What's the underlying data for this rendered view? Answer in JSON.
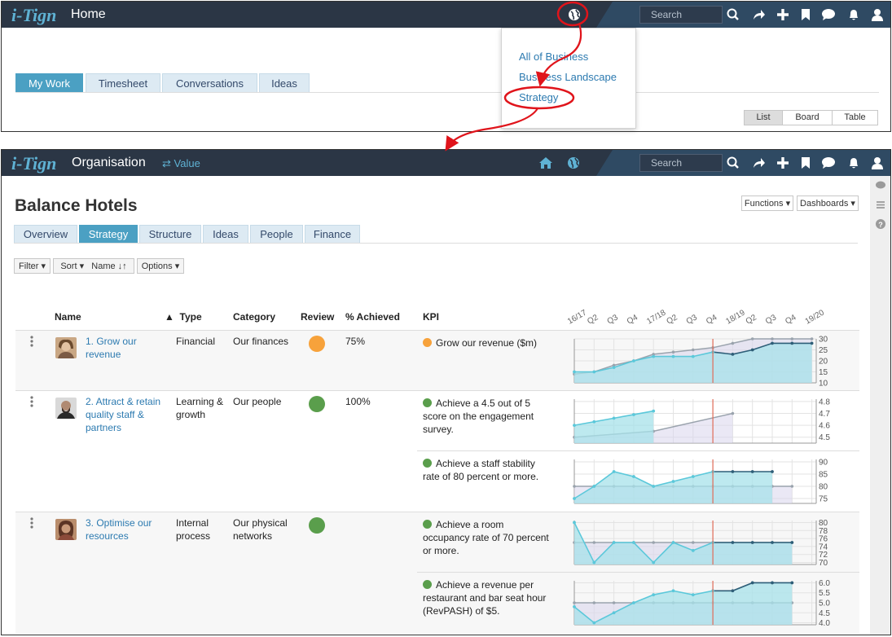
{
  "home": {
    "logo": "i-Tign",
    "title": "Home",
    "search_placeholder": "Search",
    "tabs": [
      {
        "label": "My Work",
        "active": true
      },
      {
        "label": "Timesheet",
        "active": false
      },
      {
        "label": "Conversations",
        "active": false
      },
      {
        "label": "Ideas",
        "active": false
      }
    ],
    "views": [
      "List",
      "Board",
      "Table"
    ],
    "active_view": "List",
    "dropdown": [
      "All of Business",
      "Business Landscape",
      "Strategy"
    ]
  },
  "org": {
    "logo": "i-Tign",
    "title": "Organisation",
    "value_link": "Value",
    "search_placeholder": "Search",
    "page_title": "Balance Hotels",
    "functions": "Functions",
    "dashboards": "Dashboards",
    "tabs": [
      {
        "label": "Overview",
        "active": false
      },
      {
        "label": "Strategy",
        "active": true
      },
      {
        "label": "Structure",
        "active": false
      },
      {
        "label": "Ideas",
        "active": false
      },
      {
        "label": "People",
        "active": false
      },
      {
        "label": "Finance",
        "active": false
      }
    ],
    "filter": "Filter",
    "sort": "Sort",
    "sort_by": "Name",
    "options": "Options",
    "columns": {
      "name": "Name",
      "type": "Type",
      "category": "Category",
      "review": "Review",
      "achieved": "% Achieved",
      "kpi": "KPI"
    },
    "timeline": [
      "16/17",
      "Q2",
      "Q3",
      "Q4",
      "17/18",
      "Q2",
      "Q3",
      "Q4",
      "18/19",
      "Q2",
      "Q3",
      "Q4",
      "19/20"
    ]
  },
  "objectives": [
    {
      "name": "1. Grow our revenue",
      "type": "Financial",
      "category": "Our finances",
      "review_color": "#f7a23b",
      "achieved": "75%"
    },
    {
      "name": "2. Attract & retain quality staff & partners",
      "type": "Learning & growth",
      "category": "Our people",
      "review_color": "#5a9e4c",
      "achieved": "100%"
    },
    {
      "name": "3. Optimise our resources",
      "type": "Internal process",
      "category": "Our physical networks",
      "review_color": "#5a9e4c",
      "achieved": ""
    }
  ],
  "kpis": [
    {
      "label": "Grow our revenue ($m)",
      "dot": "#f7a23b",
      "ticks": [
        "30",
        "25",
        "20",
        "15",
        "10"
      ],
      "ymin": 10,
      "ymax": 30,
      "actual": [
        15,
        15,
        17,
        20,
        22,
        22,
        22,
        24,
        23,
        25,
        28,
        28,
        28
      ],
      "target": [
        14,
        15,
        18,
        20,
        23,
        24,
        25,
        26,
        28,
        30,
        30,
        30,
        30
      ]
    },
    {
      "label": "Achieve a 4.5 out of 5 score on the engagement survey.",
      "dot": "#5a9e4c",
      "ticks": [
        "4.8",
        "4.7",
        "4.6",
        "4.5"
      ],
      "ymin": 4.45,
      "ymax": 4.82,
      "actual": [
        4.6,
        4.63,
        4.66,
        4.69,
        4.72,
        null,
        null,
        null,
        null,
        null,
        null,
        null,
        null
      ],
      "target": [
        4.5,
        null,
        null,
        null,
        4.55,
        null,
        null,
        null,
        4.7,
        null,
        null,
        null,
        null
      ]
    },
    {
      "label": "Achieve a staff stability rate of 80 percent or more.",
      "dot": "#5a9e4c",
      "ticks": [
        "90",
        "85",
        "80",
        "75"
      ],
      "ymin": 73,
      "ymax": 91,
      "actual": [
        75,
        80,
        86,
        84,
        80,
        82,
        84,
        86,
        86,
        86,
        86,
        null,
        null
      ],
      "target": [
        80,
        80,
        80,
        80,
        80,
        80,
        80,
        80,
        80,
        80,
        80,
        80,
        null
      ]
    },
    {
      "label": "Achieve a room occupancy rate of 70 percent or more.",
      "dot": "#5a9e4c",
      "ticks": [
        "80",
        "78",
        "76",
        "74",
        "72",
        "70"
      ],
      "ymin": 69.5,
      "ymax": 80.5,
      "actual": [
        80,
        70,
        75,
        75,
        70,
        75,
        73,
        75,
        75,
        75,
        75,
        75,
        null
      ],
      "target": [
        75,
        75,
        75,
        75,
        75,
        75,
        75,
        75,
        75,
        75,
        75,
        75,
        null
      ]
    },
    {
      "label": "Achieve a revenue per restaurant and bar seat hour (RevPASH) of $5.",
      "dot": "#5a9e4c",
      "ticks": [
        "6.0",
        "5.5",
        "5.0",
        "4.5",
        "4.0"
      ],
      "ymin": 3.9,
      "ymax": 6.1,
      "actual": [
        4.8,
        4.0,
        4.5,
        5.0,
        5.4,
        5.6,
        5.4,
        5.6,
        5.6,
        6.0,
        6.0,
        6.0,
        null
      ],
      "target": [
        5.0,
        5.0,
        5.0,
        5.0,
        5.0,
        5.0,
        5.0,
        5.0,
        5.0,
        5.0,
        5.0,
        5.0,
        null
      ]
    }
  ],
  "colors": {
    "topbar": "#2b3645",
    "accent": "#4ba0c3",
    "link": "#2c7ab0",
    "annot": "#e0141b",
    "teal": "#5bc8da",
    "dark": "#2e5e78"
  }
}
